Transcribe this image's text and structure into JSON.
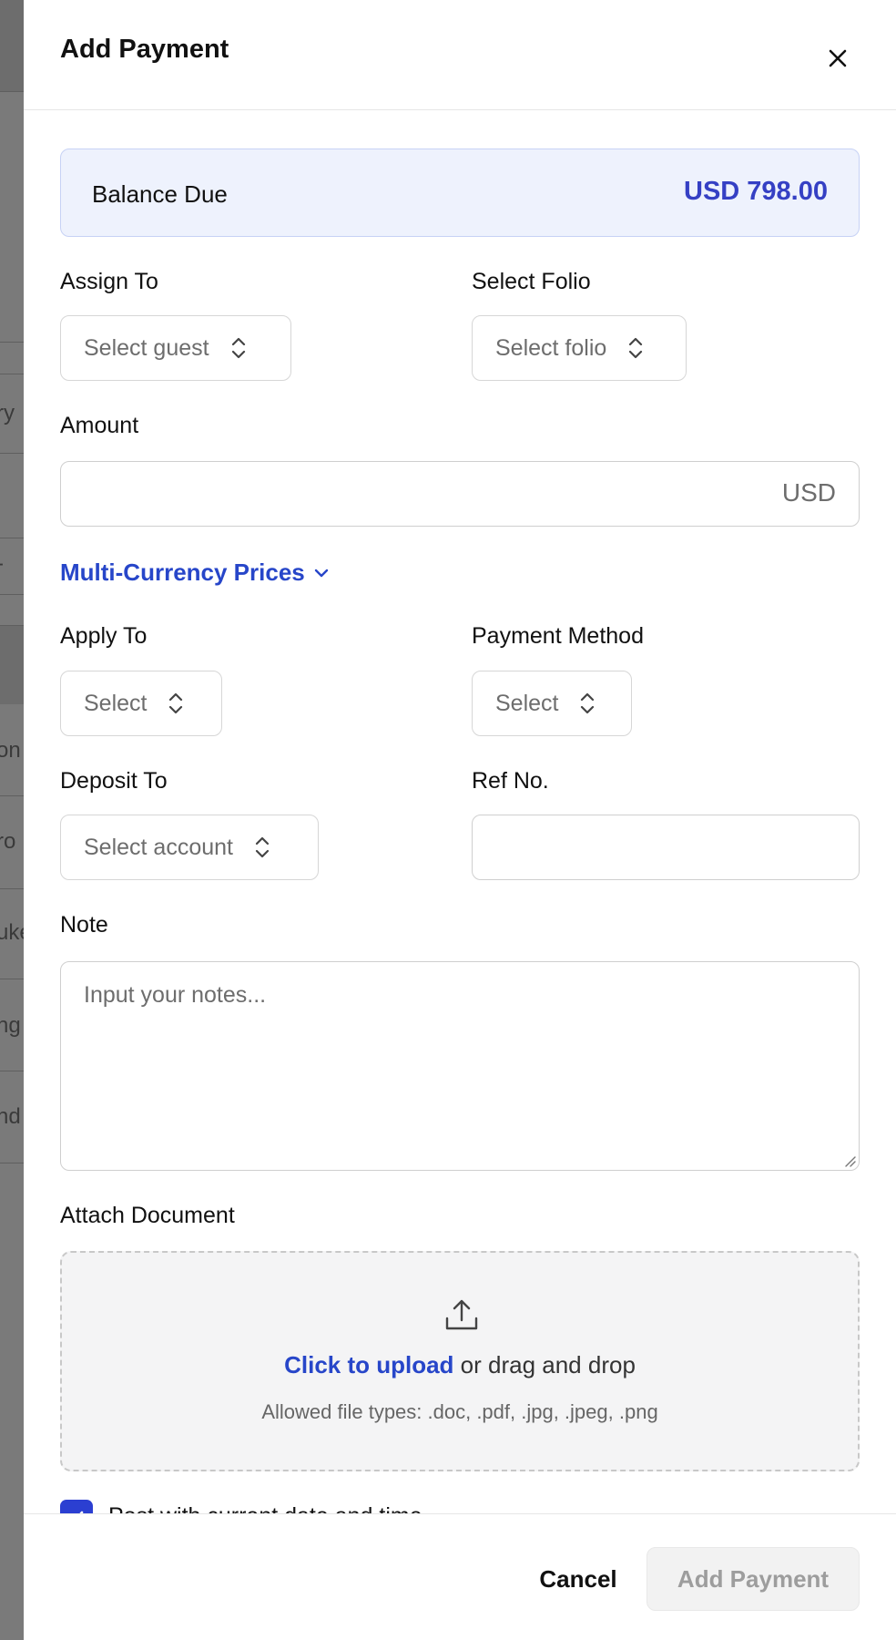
{
  "dialog": {
    "title": "Add Payment"
  },
  "balance": {
    "label": "Balance Due",
    "value": "USD 798.00"
  },
  "assign_to": {
    "label": "Assign To",
    "placeholder": "Select guest"
  },
  "select_folio": {
    "label": "Select Folio",
    "placeholder": "Select folio"
  },
  "amount": {
    "label": "Amount",
    "value": "",
    "currency": "USD"
  },
  "multi_currency": {
    "label": "Multi-Currency Prices"
  },
  "apply_to": {
    "label": "Apply To",
    "placeholder": "Select"
  },
  "payment_method": {
    "label": "Payment Method",
    "placeholder": "Select"
  },
  "deposit_to": {
    "label": "Deposit To",
    "placeholder": "Select account"
  },
  "ref_no": {
    "label": "Ref No.",
    "value": ""
  },
  "note": {
    "label": "Note",
    "placeholder": "Input your notes..."
  },
  "attach": {
    "label": "Attach Document",
    "click_text": "Click to upload",
    "drag_text": " or drag and drop",
    "allowed": "Allowed file types: .doc, .pdf, .jpg, .jpeg, .png"
  },
  "post_current": {
    "label": "Post with current date and time",
    "checked": true
  },
  "footer": {
    "cancel": "Cancel",
    "submit": "Add Payment"
  },
  "colors": {
    "accent": "#2b3fd1",
    "link": "#2746c9",
    "balance_bg": "#eef2fd"
  },
  "background_page": {
    "fragments": [
      "ry",
      "-",
      "on",
      "ro",
      "uke",
      "ng",
      "nd"
    ]
  }
}
